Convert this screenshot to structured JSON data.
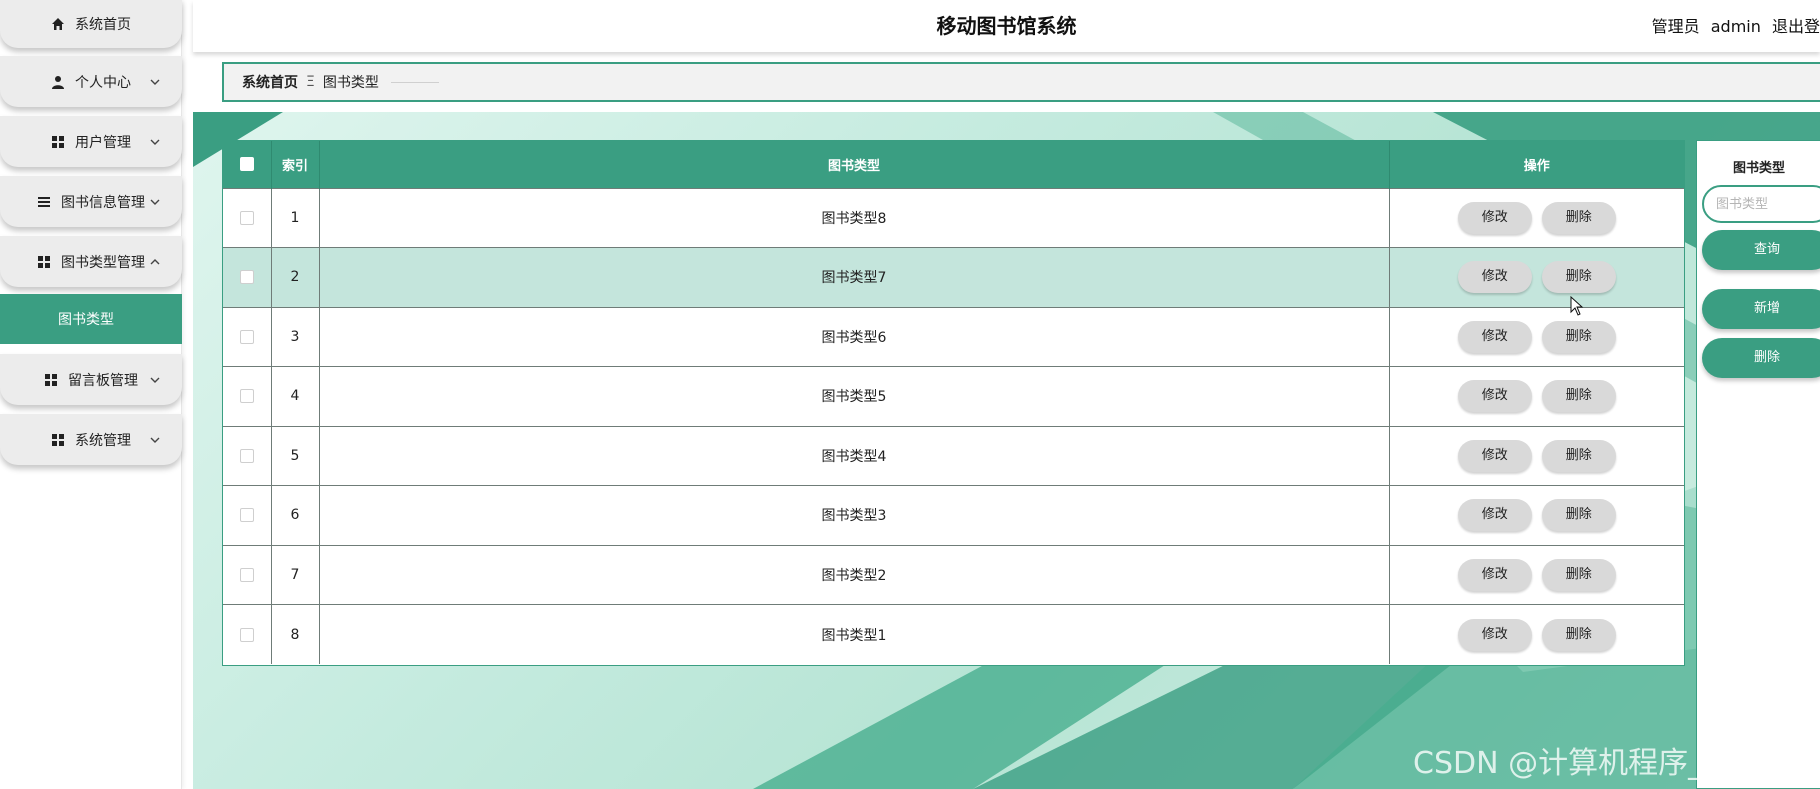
{
  "sidebar": {
    "items": [
      {
        "label": "系统首页",
        "icon": "home-icon"
      },
      {
        "label": "个人中心",
        "icon": "user-icon"
      },
      {
        "label": "用户管理",
        "icon": "grid-icon"
      },
      {
        "label": "图书信息管理",
        "icon": "list-icon"
      },
      {
        "label": "图书类型管理",
        "icon": "grid-icon"
      },
      {
        "label": "留言板管理",
        "icon": "grid-icon"
      },
      {
        "label": "系统管理",
        "icon": "grid-icon"
      }
    ],
    "active_submenu": "图书类型"
  },
  "header": {
    "title": "移动图书馆系统",
    "role": "管理员",
    "username": "admin",
    "logout": "退出登"
  },
  "breadcrumb": {
    "home": "系统首页",
    "separator": "Ξ",
    "current": "图书类型"
  },
  "table": {
    "columns": [
      "",
      "索引",
      "图书类型",
      "操作"
    ],
    "rows": [
      {
        "index": "1",
        "type": "图书类型8"
      },
      {
        "index": "2",
        "type": "图书类型7"
      },
      {
        "index": "3",
        "type": "图书类型6"
      },
      {
        "index": "4",
        "type": "图书类型5"
      },
      {
        "index": "5",
        "type": "图书类型4"
      },
      {
        "index": "6",
        "type": "图书类型3"
      },
      {
        "index": "7",
        "type": "图书类型2"
      },
      {
        "index": "8",
        "type": "图书类型1"
      }
    ],
    "edit_label": "修改",
    "delete_label": "删除"
  },
  "search": {
    "label": "图书类型",
    "placeholder": "图书类型",
    "query_label": "查询",
    "add_label": "新增",
    "delete_label": "删除"
  },
  "watermark": "CSDN @计算机程序_设计",
  "colors": {
    "accent": "#3a9e82",
    "hover_row": "#c4e5dc",
    "op_button": "#d9d9d9"
  }
}
